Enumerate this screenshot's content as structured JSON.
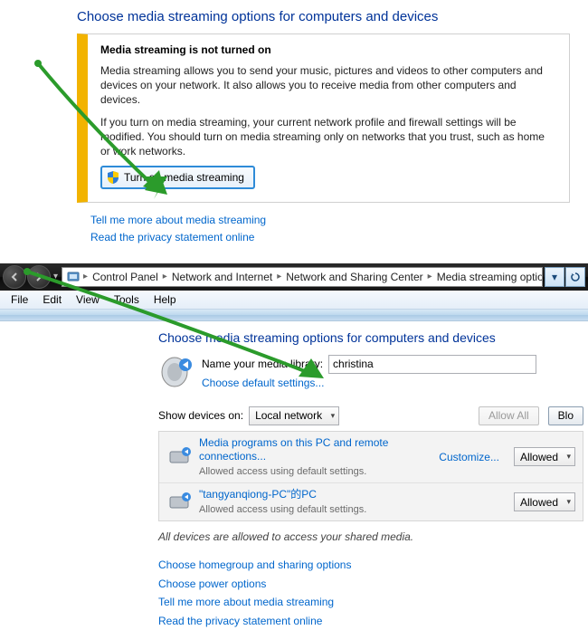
{
  "top": {
    "title": "Choose media streaming options for computers and devices",
    "warning": {
      "heading": "Media streaming is not turned on",
      "para1": "Media streaming allows you to send your music, pictures and videos to other computers and devices on your network.  It also allows you to receive media from other computers and devices.",
      "para2": "If you turn on media streaming, your current network profile and firewall settings will be modified. You should turn on media streaming only on networks that you trust, such as home or work networks.",
      "button_label": "Turn on media streaming"
    },
    "link1": "Tell me more about media streaming",
    "link2": "Read the privacy statement online"
  },
  "window": {
    "breadcrumbs": [
      "Control Panel",
      "Network and Internet",
      "Network and Sharing Center",
      "Media streaming options"
    ],
    "menu": [
      "File",
      "Edit",
      "View",
      "Tools",
      "Help"
    ],
    "title": "Choose media streaming options for computers and devices",
    "library_label": "Name your media library:",
    "library_value": "christina",
    "choose_defaults": "Choose default settings...",
    "show_devices_label": "Show devices on:",
    "show_devices_value": "Local network",
    "allow_all": "Allow All",
    "block_all": "Blo",
    "devices": [
      {
        "name": "Media programs on this PC and remote connections...",
        "sub": "Allowed access using default settings.",
        "customize": "Customize...",
        "status": "Allowed"
      },
      {
        "name": "\"tangyanqiong-PC\"的PC",
        "sub": "Allowed access using default settings.",
        "customize": "",
        "status": "Allowed"
      }
    ],
    "note": "All devices are allowed to access your shared media.",
    "links": [
      "Choose homegroup and sharing options",
      "Choose power options",
      "Tell me more about media streaming",
      "Read the privacy statement online"
    ]
  }
}
